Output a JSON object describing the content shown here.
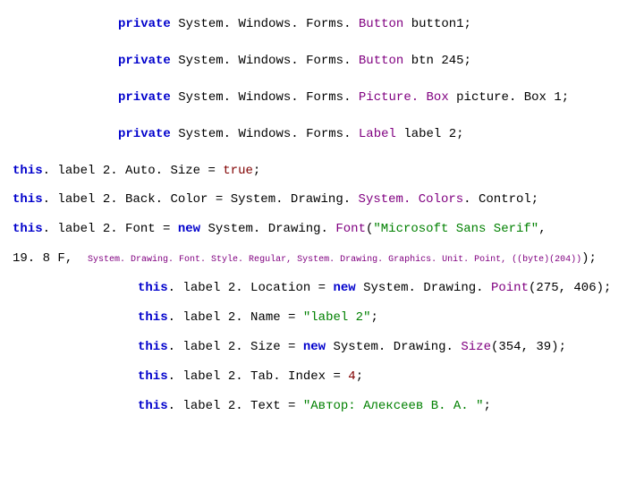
{
  "decl": {
    "private": "private",
    "system": "System",
    "windows": "Windows",
    "forms": "Forms",
    "button_t": "Button",
    "picturebox_t": "Picture. Box",
    "label_t": "Label",
    "names": {
      "button1": "button1",
      "btn245": "btn 245",
      "picturebox1": "picture. Box 1",
      "label2": "label 2"
    }
  },
  "stmt": {
    "this": "this",
    "label2": "label 2",
    "autosize": "Auto. Size",
    "eq": " = ",
    "true": "true",
    "semi": ";",
    "backcolor": "Back. Color",
    "drawing": "Drawing",
    "systemcolors": "System. Colors",
    "control": "Control",
    "font": "Font",
    "new": "new",
    "font_t": "Font",
    "msss": "\"Microsoft Sans Serif\"",
    "size198": "19. 8 F",
    "comma_sp": ",  ",
    "fontstyle": "System. Drawing. Font. Style. Regular, System. Drawing. Graphics. Unit. Point, ((byte)(204))",
    "close_paren_semi": ");",
    "location": "Location",
    "point_t": "Point",
    "loc_args": "(275, 406)",
    "name": "Name",
    "name_val": "\"label 2\"",
    "size": "Size",
    "size_t": "Size",
    "size_args": "(354, 39)",
    "tabindex": "Tab. Index",
    "tabindex_val": "4",
    "text": "Text",
    "text_val": "\"Автор: Алексеев В. А. \""
  }
}
